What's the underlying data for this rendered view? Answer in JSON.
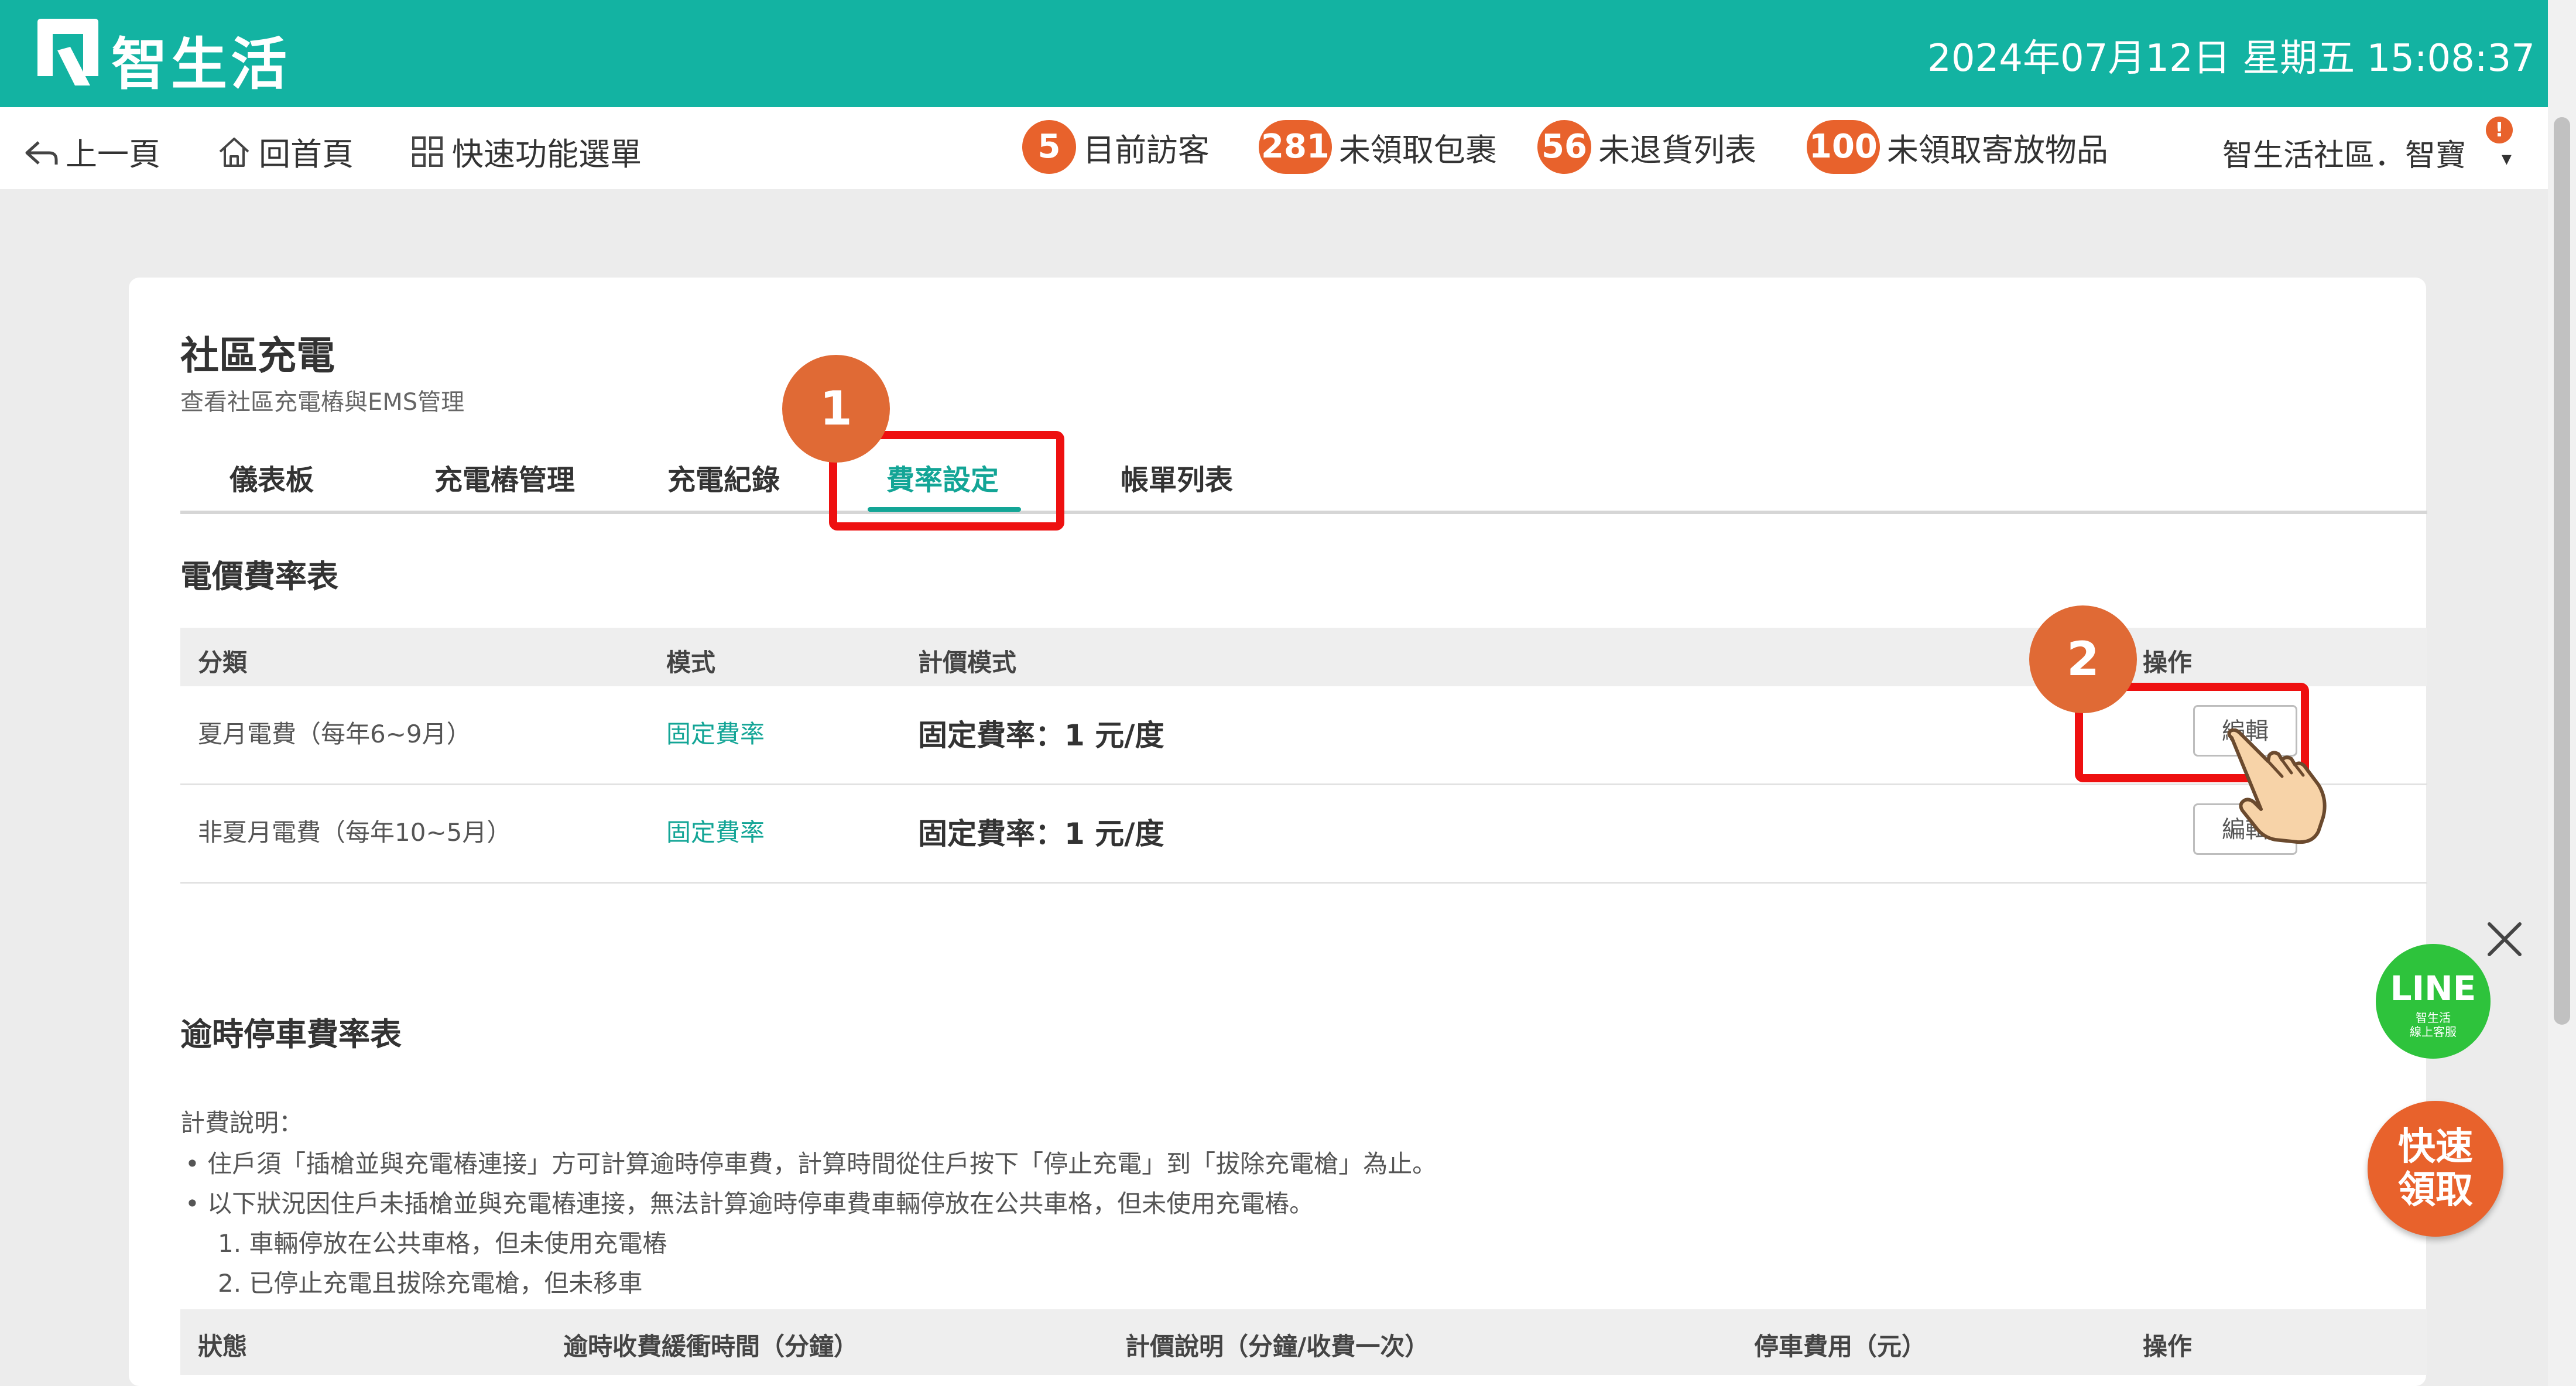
{
  "header": {
    "brand": "智生活",
    "datetime": "2024年07月12日 星期五 15:08:37"
  },
  "nav": {
    "back": "上一頁",
    "home": "回首頁",
    "menu": "快速功能選單",
    "stats": [
      {
        "count": "5",
        "label": "目前訪客"
      },
      {
        "count": "281",
        "label": "未領取包裹"
      },
      {
        "count": "56",
        "label": "未退貨列表"
      },
      {
        "count": "100",
        "label": "未領取寄放物品"
      }
    ],
    "user": "智生活社區．智寶",
    "alert": "!"
  },
  "page": {
    "title": "社區充電",
    "subtitle": "查看社區充電樁與EMS管理"
  },
  "tabs": [
    "儀表板",
    "充電樁管理",
    "充電紀錄",
    "費率設定",
    "帳單列表"
  ],
  "steps": [
    "1",
    "2"
  ],
  "rate_table": {
    "title": "電價費率表",
    "headers": [
      "分類",
      "模式",
      "計價模式",
      "操作"
    ],
    "rows": [
      {
        "category": "夏月電費（每年6~9月）",
        "mode": "固定費率",
        "pricing": "固定費率：1 元/度",
        "action": "編輯"
      },
      {
        "category": "非夏月電費（每年10~5月）",
        "mode": "固定費率",
        "pricing": "固定費率：1 元/度",
        "action": "編輯"
      }
    ]
  },
  "parking": {
    "title": "逾時停車費率表",
    "note_title": "計費說明：",
    "notes": [
      "住戶須「插槍並與充電樁連接」方可計算逾時停車費，計算時間從住戶按下「停止充電」到「拔除充電槍」為止。",
      "以下狀況因住戶未插槍並與充電樁連接，無法計算逾時停車費車輛停放在公共車格，但未使用充電樁。"
    ],
    "sub_notes": [
      "1. 車輛停放在公共車格，但未使用充電樁",
      "2. 已停止充電且拔除充電槍，但未移車"
    ],
    "headers": [
      "狀態",
      "逾時收費緩衝時間（分鐘）",
      "計價說明（分鐘/收費一次）",
      "停車費用（元）",
      "操作"
    ]
  },
  "floating": {
    "line_main": "LINE",
    "line_sub1": "智生活",
    "line_sub2": "線上客服",
    "quick1": "快速",
    "quick2": "領取"
  },
  "colors": {
    "brand": "#13b3a2",
    "accent": "#e8622c",
    "highlight": "#ee1010",
    "line": "#2ec33c"
  }
}
